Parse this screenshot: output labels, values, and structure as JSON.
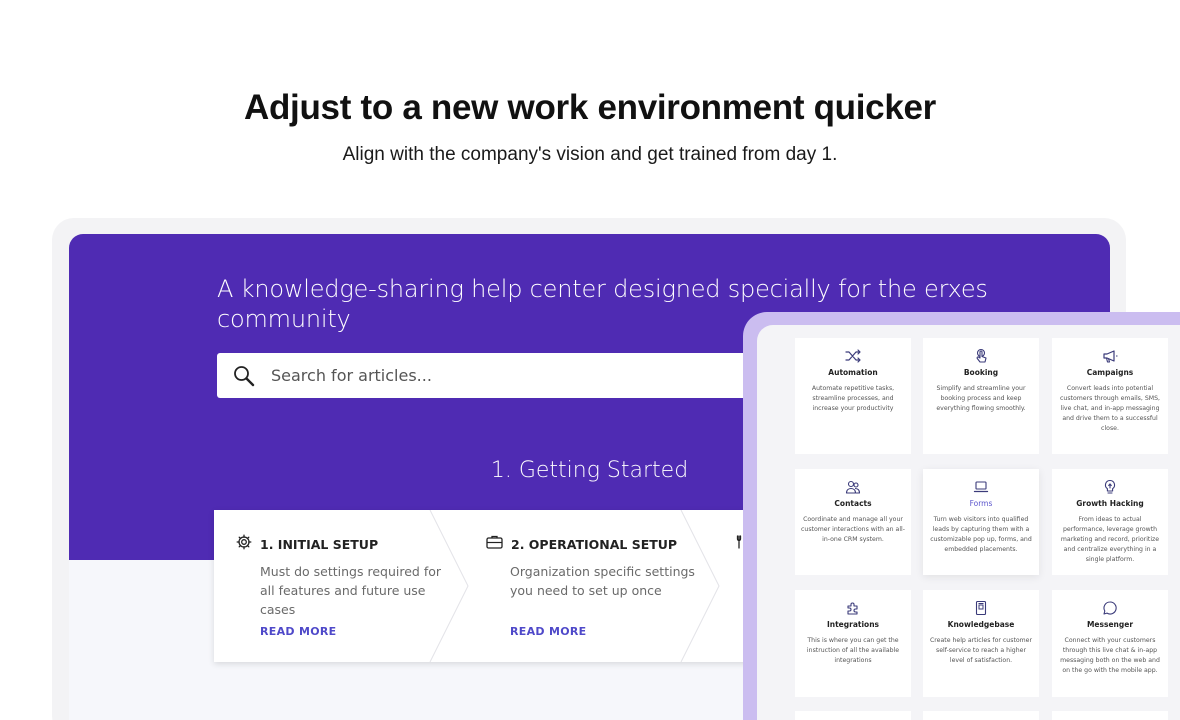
{
  "page": {
    "headline": "Adjust to a new work environment quicker",
    "subheadline": "Align with the company's vision and get trained from day 1."
  },
  "helpcenter": {
    "hero_title": "A knowledge-sharing help center designed specially for the erxes community",
    "search_placeholder": "Search for articles...",
    "section_title": "1. Getting Started",
    "steps": [
      {
        "icon": "gear-icon",
        "title": "1. INITIAL SETUP",
        "description": "Must do settings required for all features and future use cases",
        "link": "READ MORE"
      },
      {
        "icon": "briefcase-icon",
        "title": "2. OPERATIONAL SETUP",
        "description": "Organization specific settings you need to set up once",
        "link": "READ MORE"
      },
      {
        "icon": "tools-icon"
      }
    ]
  },
  "features": {
    "cards": [
      {
        "icon": "shuffle-icon",
        "title": "Automation",
        "description": "Automate repetitive tasks, streamline processes, and increase your productivity"
      },
      {
        "icon": "hand-pointer-icon",
        "title": "Booking",
        "description": "Simplify and streamline your booking process and keep everything flowing smoothly."
      },
      {
        "icon": "megaphone-icon",
        "title": "Campaigns",
        "description": "Convert leads into potential customers through emails, SMS, live chat, and in-app messaging and drive them to a successful close."
      },
      {
        "icon": "users-icon",
        "title": "Contacts",
        "description": "Coordinate and manage all your customer interactions with an all-in-one CRM system."
      },
      {
        "icon": "laptop-icon",
        "title": "Forms",
        "description": "Turn web visitors into qualified leads by capturing them with a customizable pop up, forms, and embedded placements."
      },
      {
        "icon": "lightbulb-icon",
        "title": "Growth Hacking",
        "description": "From ideas to actual performance, leverage growth marketing and record, prioritize and centralize everything in a single platform."
      },
      {
        "icon": "puzzle-icon",
        "title": "Integrations",
        "description": "This is where you can get the instruction of all the available integrations"
      },
      {
        "icon": "book-icon",
        "title": "Knowledgebase",
        "description": "Create help articles for customer self-service to reach a higher level of satisfaction."
      },
      {
        "icon": "chat-bubble-icon",
        "title": "Messenger",
        "description": "Connect with your customers through this live chat & in-app messaging both on the web and on the go with the mobile app."
      }
    ]
  },
  "colors": {
    "hero": "#4f2bb3",
    "accent": "#5b55cc",
    "panel_border": "#cbbdf0"
  }
}
